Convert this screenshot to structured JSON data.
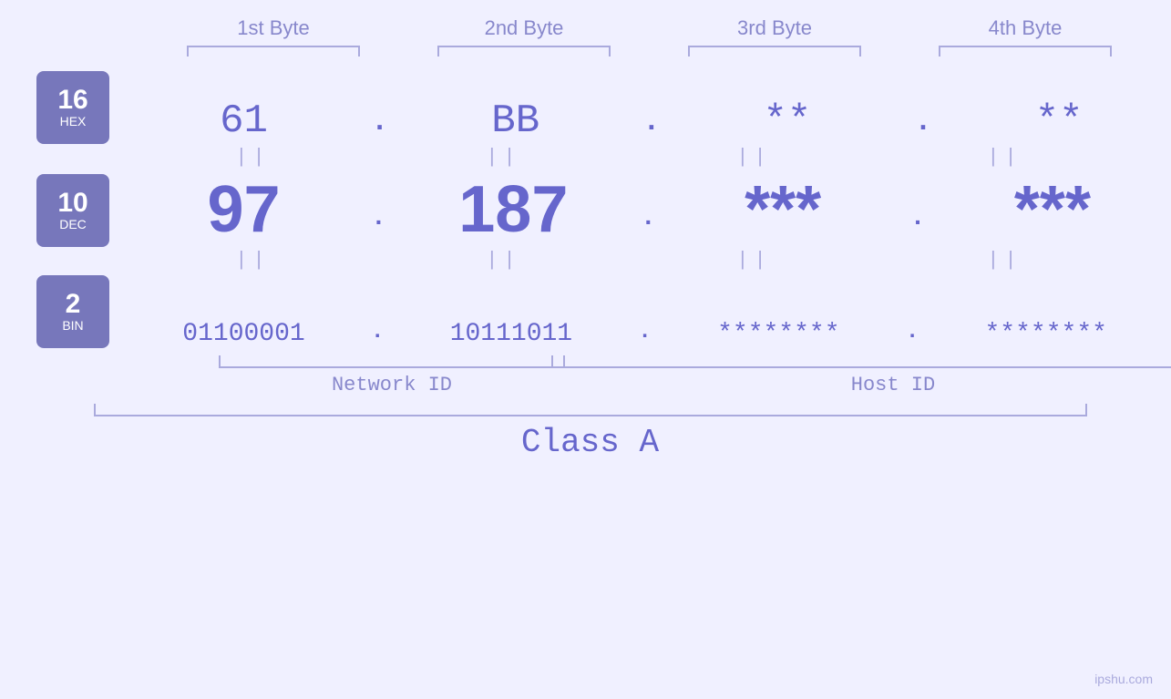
{
  "header": {
    "byte1": "1st Byte",
    "byte2": "2nd Byte",
    "byte3": "3rd Byte",
    "byte4": "4th Byte"
  },
  "badges": {
    "hex": {
      "number": "16",
      "label": "HEX"
    },
    "dec": {
      "number": "10",
      "label": "DEC"
    },
    "bin": {
      "number": "2",
      "label": "BIN"
    }
  },
  "rows": {
    "hex": {
      "b1": "61",
      "b2": "BB",
      "b3": "**",
      "b4": "**"
    },
    "dec": {
      "b1": "97",
      "b2": "187",
      "b3": "***",
      "b4": "***"
    },
    "bin": {
      "b1": "01100001",
      "b2": "10111011",
      "b3": "********",
      "b4": "********"
    }
  },
  "equals": "||",
  "labels": {
    "network_id": "Network ID",
    "host_id": "Host ID",
    "class": "Class A"
  },
  "watermark": "ipshu.com",
  "colors": {
    "accent": "#6666cc",
    "light": "#aaaadd",
    "badge_bg": "#7777bb",
    "bg": "#f0f0ff"
  }
}
